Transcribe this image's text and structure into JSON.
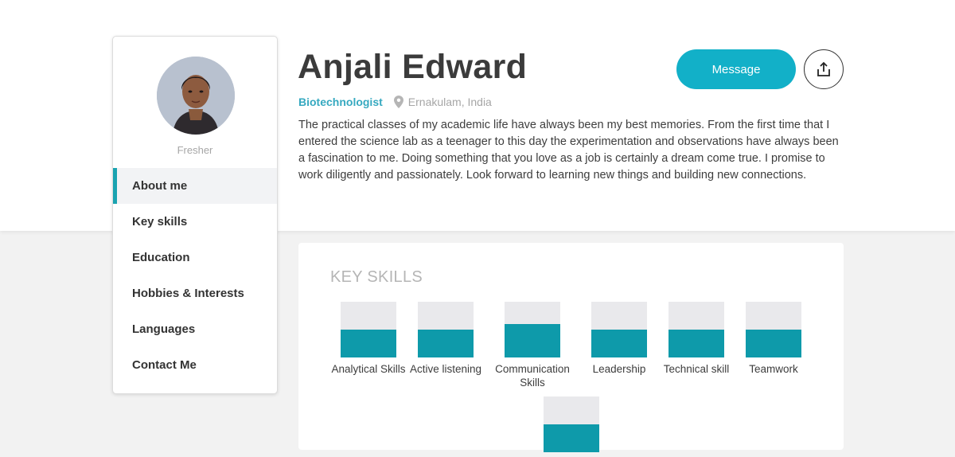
{
  "profile": {
    "name": "Anjali Edward",
    "role": "Biotechnologist",
    "location": "Ernakulam, India",
    "status": "Fresher",
    "bio": "The practical classes of my academic life have always been my best memories. From the first time that I entered the science lab as a teenager to this day the experimentation and observations have always been a fascination to me. Doing something that you love as a job is certainly a dream come true. I promise to work diligently and passionately. Look forward to learning new things and building new connections."
  },
  "actions": {
    "message_label": "Message",
    "share_icon": "share-icon"
  },
  "sidebar": {
    "items": [
      {
        "label": "About me",
        "active": true
      },
      {
        "label": "Key skills",
        "active": false
      },
      {
        "label": "Education",
        "active": false
      },
      {
        "label": "Hobbies & Interests",
        "active": false
      },
      {
        "label": "Languages",
        "active": false
      },
      {
        "label": "Contact Me",
        "active": false
      }
    ]
  },
  "skills": {
    "title": "KEY SKILLS",
    "items": [
      {
        "label": "Analytical Skills",
        "level": 0.5
      },
      {
        "label": "Active listening",
        "level": 0.5
      },
      {
        "label": "Communication Skills",
        "level": 0.6
      },
      {
        "label": "Leadership",
        "level": 0.5
      },
      {
        "label": "Technical skill",
        "level": 0.5
      },
      {
        "label": "Teamwork",
        "level": 0.5
      },
      {
        "label": "",
        "level": 0.5
      }
    ]
  },
  "colors": {
    "accent": "#12b0c8",
    "bar_fill": "#0e9aaa",
    "role": "#36a9c0"
  }
}
